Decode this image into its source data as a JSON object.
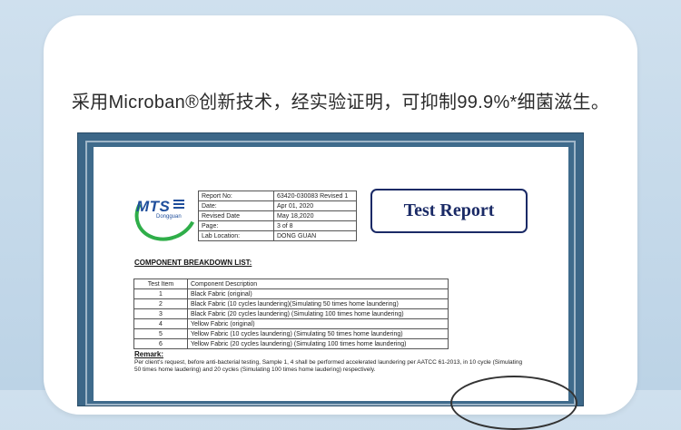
{
  "caption": "采用Microban®创新技术，经实验证明，可抑制99.9%*细菌滋生。",
  "logo": {
    "name": "MTS",
    "sub": "Dongguan"
  },
  "report_info": [
    {
      "key": "Report No:",
      "value": "63420-030083 Revised 1"
    },
    {
      "key": "Date:",
      "value": "Apr 01, 2020"
    },
    {
      "key": "Revised Date",
      "value": "May 18,2020"
    },
    {
      "key": "Page:",
      "value": "3 of 8"
    },
    {
      "key": "Lab Location:",
      "value": "DONG GUAN"
    }
  ],
  "report_title": "Test Report",
  "component_list": {
    "title": "COMPONENT BREAKDOWN LIST:",
    "headers": {
      "item": "Test Item",
      "desc": "Component Description"
    },
    "rows": [
      {
        "item": "1",
        "desc": "Black Fabric (original)"
      },
      {
        "item": "2",
        "desc": "Black Fabric (10 cycles laundering)(Simulating 50 times home laundering)"
      },
      {
        "item": "3",
        "desc": "Black Fabric (20 cycles laundering) (Simulating 100 times home laundering)"
      },
      {
        "item": "4",
        "desc": "Yellow Fabric (original)"
      },
      {
        "item": "5",
        "desc": "Yellow Fabric (10 cycles laundering) (Simulating 50 times home laundering)"
      },
      {
        "item": "6",
        "desc": "Yellow Fabric (20 cycles laundering) (Simulating 100 times home laundering)"
      }
    ]
  },
  "remark": {
    "title": "Remark:",
    "text": "Per client's request, before anti-bacterial testing, Sample 1, 4 shall be performed accelerated laundering per AATCC 61-2013, in 10 cycle (Simulating 50 times home laudering) and 20 cycles (Simulating 100 times home laudering) respectively."
  }
}
